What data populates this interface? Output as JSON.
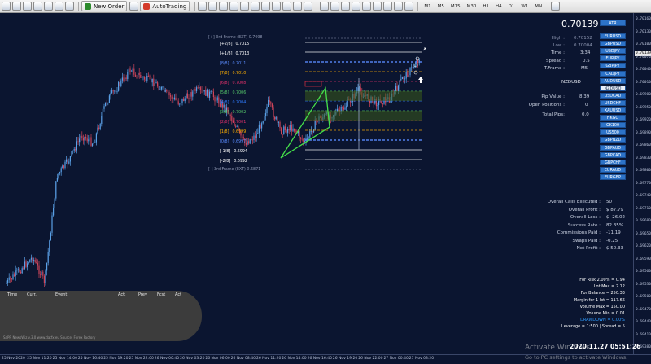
{
  "toolbar": {
    "new_order": "New Order",
    "auto_trading": "AutoTrading",
    "timeframes": [
      "M1",
      "M5",
      "M15",
      "M30",
      "H1",
      "H4",
      "D1",
      "W1",
      "MN"
    ]
  },
  "fibo": {
    "top_caption": "[+] 3rd Frame (EXT) 0.7098",
    "bottom_caption": "[-] 3rd Frame (EXT) 0.6871",
    "levels": [
      {
        "label": "[+2/8]",
        "value": "0.7015",
        "color": "#ffffff"
      },
      {
        "label": "[+1/8]",
        "value": "0.7013",
        "color": "#ffffff"
      },
      {
        "label": "[8/8]",
        "value": "0.7011",
        "color": "#5a8cff"
      },
      {
        "label": "[7/8]",
        "value": "0.7010",
        "color": "#ffb000"
      },
      {
        "label": "[6/8]",
        "value": "0.7008",
        "color": "#e0306a"
      },
      {
        "label": "[5/8]",
        "value": "0.7006",
        "color": "#55c76a"
      },
      {
        "label": "[4/8]",
        "value": "0.7004",
        "color": "#2f7cff"
      },
      {
        "label": "[3/8]",
        "value": "0.7002",
        "color": "#55c76a"
      },
      {
        "label": "[2/8]",
        "value": "0.7001",
        "color": "#e0306a"
      },
      {
        "label": "[1/8]",
        "value": "0.6999",
        "color": "#ffb000"
      },
      {
        "label": "[0/8]",
        "value": "0.6997",
        "color": "#5a8cff"
      },
      {
        "label": "[-1/8]",
        "value": "0.6994",
        "color": "#ffffff"
      },
      {
        "label": "[-2/8]",
        "value": "0.6992",
        "color": "#ffffff"
      }
    ]
  },
  "price_scale": {
    "current_tag": "0.70139",
    "ticks": [
      "0.70160",
      "0.70130",
      "0.70100",
      "0.70070",
      "0.70040",
      "0.70010",
      "0.69980",
      "0.69950",
      "0.69920",
      "0.69890",
      "0.69860",
      "0.69830",
      "0.69800",
      "0.69770",
      "0.69740",
      "0.69710",
      "0.69680",
      "0.69650",
      "0.69620",
      "0.69590",
      "0.69560",
      "0.69530",
      "0.69500",
      "0.69470",
      "0.69440",
      "0.69410",
      "0.69380"
    ]
  },
  "time_axis": [
    "25 Nov 2020",
    "25 Nov 11:20",
    "25 Nov 14:00",
    "25 Nov 16:40",
    "25 Nov 19:20",
    "25 Nov 22:00",
    "26 Nov 00:40",
    "26 Nov 03:20",
    "26 Nov 06:00",
    "26 Nov 08:40",
    "26 Nov 11:20",
    "26 Nov 14:00",
    "26 Nov 16:40",
    "26 Nov 19:20",
    "26 Nov 22:00",
    "27 Nov 00:40",
    "27 Nov 03:20"
  ],
  "news": {
    "headers": [
      "Time",
      "Curr.",
      "Event",
      "Act.",
      "Prev",
      "Fcst",
      "Act"
    ],
    "footer": "SaPR NewsWiz v.3.0   www.datfx.eu     Source: Forex Factory"
  },
  "info": {
    "price": "0.70139",
    "atr_button": "ATR",
    "high_label": "High :",
    "high_value": "0.70152",
    "low_label": "Low :",
    "low_value": "0.70004",
    "time_label": "Time :",
    "time_value": "3:34",
    "spread_label": "Spread :",
    "spread_value": "0.5",
    "tframe_label": "T.Frame :",
    "tframe_value": "M5",
    "symbol": "NZDUSD",
    "pip_label": "Pip Value :",
    "pip_value": "8.39",
    "open_label": "Open Positions :",
    "open_value": "0",
    "total_label": "Total Pips:",
    "total_value": "0.0"
  },
  "symbols": [
    "EURUSD",
    "GBPUSD",
    "USDJPY",
    "EURJPY",
    "GBPJPY",
    "CADJPY",
    "AUDUSD",
    "NZDUSD",
    "USDCAD",
    "USDCHF",
    "XAUUSD",
    "HKGO",
    "GK100",
    "US500",
    "GBPNZD",
    "GBPAUD",
    "GBPCAD",
    "GBPCHF",
    "EURAUD",
    "EURGBP"
  ],
  "active_symbol": "NZDUSD",
  "stats": [
    {
      "label": "Overall Calls Executed :",
      "value": "50"
    },
    {
      "label": "Overall Profit :",
      "value": "$ 87.79"
    },
    {
      "label": "Overall Loss :",
      "value": "$ -26.02"
    },
    {
      "label": "Success Rate :",
      "value": "82.35%"
    },
    {
      "label": "Commissions Paid :",
      "value": "-11.19"
    },
    {
      "label": "Swaps Paid :",
      "value": "-0.25"
    },
    {
      "label": "Net Profit :",
      "value": "$ 50.33"
    }
  ],
  "risk": [
    {
      "text": "For Risk 2.00% = 0.94",
      "color": "#ffffff"
    },
    {
      "text": "Lot Max = 2.12",
      "color": "#ffffff"
    },
    {
      "text": "For Balance = 250.33",
      "color": "#ffffff"
    },
    {
      "text": "Margin for 1 lot = 117.66",
      "color": "#ffffff"
    },
    {
      "text": "Volume Max = 150.00",
      "color": "#ffffff"
    },
    {
      "text": "Volume Min = 0.01",
      "color": "#ffffff"
    },
    {
      "text": "DRAWDOWN = 0.00%",
      "color": "#2d9cff"
    },
    {
      "text": "Leverage = 1:500 | Spread = 5",
      "color": "#ffffff"
    }
  ],
  "datetime": "2020.11.27 05:51:26",
  "watermark": {
    "line1": "Activate Windows",
    "line2": "Go to PC settings to activate Windows."
  }
}
